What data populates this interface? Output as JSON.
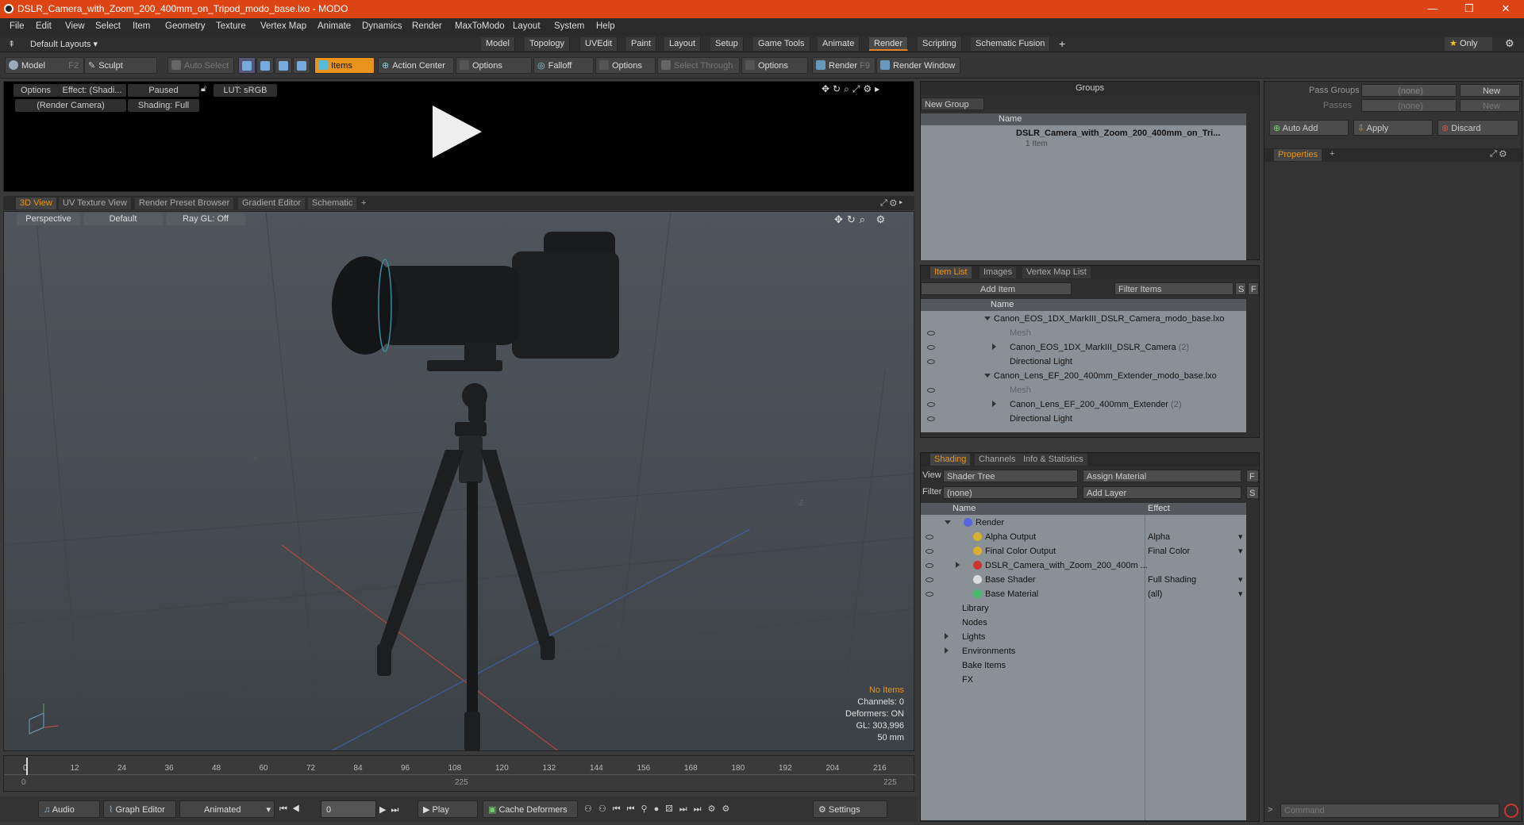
{
  "window": {
    "title": "DSLR_Camera_with_Zoom_200_400mm_on_Tripod_modo_base.lxo - MODO",
    "minimize": "—",
    "maximize": "❐",
    "close": "✕"
  },
  "menu": [
    "File",
    "Edit",
    "View",
    "Select",
    "Item",
    "Geometry",
    "Texture",
    "Vertex Map",
    "Animate",
    "Dynamics",
    "Render",
    "MaxToModo",
    "Layout",
    "System",
    "Help"
  ],
  "layouts": {
    "default": "Default Layouts ▾",
    "tabs": [
      "Model",
      "Topology",
      "UVEdit",
      "Paint",
      "Layout",
      "Setup",
      "Game Tools",
      "Animate",
      "Render",
      "Scripting",
      "Schematic Fusion"
    ],
    "active": "Render",
    "add": "+",
    "only": "Only"
  },
  "toolbar": {
    "model": "Model",
    "model_key": "F2",
    "sculpt": "Sculpt",
    "auto_select": "Auto Select",
    "items": "Items",
    "action_center": "Action Center",
    "options1": "Options",
    "falloff": "Falloff",
    "options2": "Options",
    "select_through": "Select Through",
    "options3": "Options",
    "render": "Render",
    "render_key": "F9",
    "render_window": "Render Window"
  },
  "preview": {
    "options": "Options",
    "effect": "Effect: (Shadi...",
    "paused": "Paused",
    "lut": "LUT: sRGB",
    "camera": "(Render Camera)",
    "shading": "Shading: Full"
  },
  "viewport_tabs": [
    "3D View",
    "UV Texture View",
    "Render Preset Browser",
    "Gradient Editor",
    "Schematic"
  ],
  "viewport_tab_add": "+",
  "viewport": {
    "perspective": "Perspective",
    "default": "Default",
    "raygl": "Ray GL: Off",
    "axis_x": "-X",
    "axis_z": "-Z"
  },
  "stats": {
    "no_items": "No Items",
    "channels": "Channels: 0",
    "deformers": "Deformers: ON",
    "gl": "GL: 303,996",
    "mm": "50 mm"
  },
  "timeline": {
    "ticks": [
      "0",
      "12",
      "24",
      "36",
      "48",
      "60",
      "72",
      "84",
      "96",
      "108",
      "120",
      "132",
      "144",
      "156",
      "168",
      "180",
      "192",
      "204",
      "216"
    ],
    "start": "0",
    "mid": "225",
    "end": "225"
  },
  "bottombar": {
    "audio": "Audio",
    "graph_editor": "Graph Editor",
    "animated": "Animated",
    "frame": "0",
    "play": "Play",
    "cache": "Cache Deformers",
    "settings": "Settings"
  },
  "groups": {
    "title": "Groups",
    "new_group": "New Group",
    "col_name": "Name",
    "item_name": "DSLR_Camera_with_Zoom_200_400mm_on_Tri...",
    "item_sub": "1 Item"
  },
  "itemlist": {
    "tabs": [
      "Item List",
      "Images",
      "Vertex Map List"
    ],
    "add_item": "Add Item",
    "filter": "Filter Items",
    "s": "S",
    "f": "F",
    "col_name": "Name",
    "rows": [
      {
        "label": "Canon_EOS_1DX_MarkIII_DSLR_Camera_modo_base.lxo",
        "kind": "scene"
      },
      {
        "label": "Mesh",
        "kind": "ghost"
      },
      {
        "label": "Canon_EOS_1DX_MarkIII_DSLR_Camera",
        "count": "(2)",
        "kind": "item"
      },
      {
        "label": "Directional Light",
        "kind": "light"
      },
      {
        "label": "Canon_Lens_EF_200_400mm_Extender_modo_base.lxo",
        "kind": "scene"
      },
      {
        "label": "Mesh",
        "kind": "ghost"
      },
      {
        "label": "Canon_Lens_EF_200_400mm_Extender",
        "count": "(2)",
        "kind": "item"
      },
      {
        "label": "Directional Light",
        "kind": "light"
      }
    ]
  },
  "shading": {
    "tabs": [
      "Shading",
      "Channels",
      "Info & Statistics"
    ],
    "view_label": "View",
    "view_value": "Shader Tree",
    "assign": "Assign Material",
    "filter_label": "Filter",
    "filter_value": "(none)",
    "add_layer": "Add Layer",
    "f": "F",
    "s": "S",
    "col_name": "Name",
    "col_effect": "Effect",
    "rows": [
      {
        "label": "Render",
        "effect": "",
        "color": "#5566dd"
      },
      {
        "label": "Alpha Output",
        "effect": "Alpha",
        "color": "#d8b030"
      },
      {
        "label": "Final Color Output",
        "effect": "Final Color",
        "color": "#d8b030"
      },
      {
        "label": "DSLR_Camera_with_Zoom_200_400m ...",
        "effect": "",
        "color": "#cc3333"
      },
      {
        "label": "Base Shader",
        "effect": "Full Shading",
        "color": "#dddddd"
      },
      {
        "label": "Base Material",
        "effect": "(all)",
        "color": "#44bb66"
      },
      {
        "label": "Library",
        "effect": "",
        "color": ""
      },
      {
        "label": "Nodes",
        "effect": "",
        "color": ""
      },
      {
        "label": "Lights",
        "effect": "",
        "color": ""
      },
      {
        "label": "Environments",
        "effect": "",
        "color": ""
      },
      {
        "label": "Bake Items",
        "effect": "",
        "color": ""
      },
      {
        "label": "FX",
        "effect": "",
        "color": ""
      }
    ]
  },
  "passes": {
    "pass_groups": "Pass Groups",
    "passes": "Passes",
    "none1": "(none)",
    "none2": "(none)",
    "new1": "New",
    "new2": "New",
    "auto_add": "Auto Add",
    "apply": "Apply",
    "discard": "Discard"
  },
  "properties": {
    "tab": "Properties",
    "add": "+"
  },
  "command": {
    "placeholder": "Command",
    "prompt": ">"
  }
}
